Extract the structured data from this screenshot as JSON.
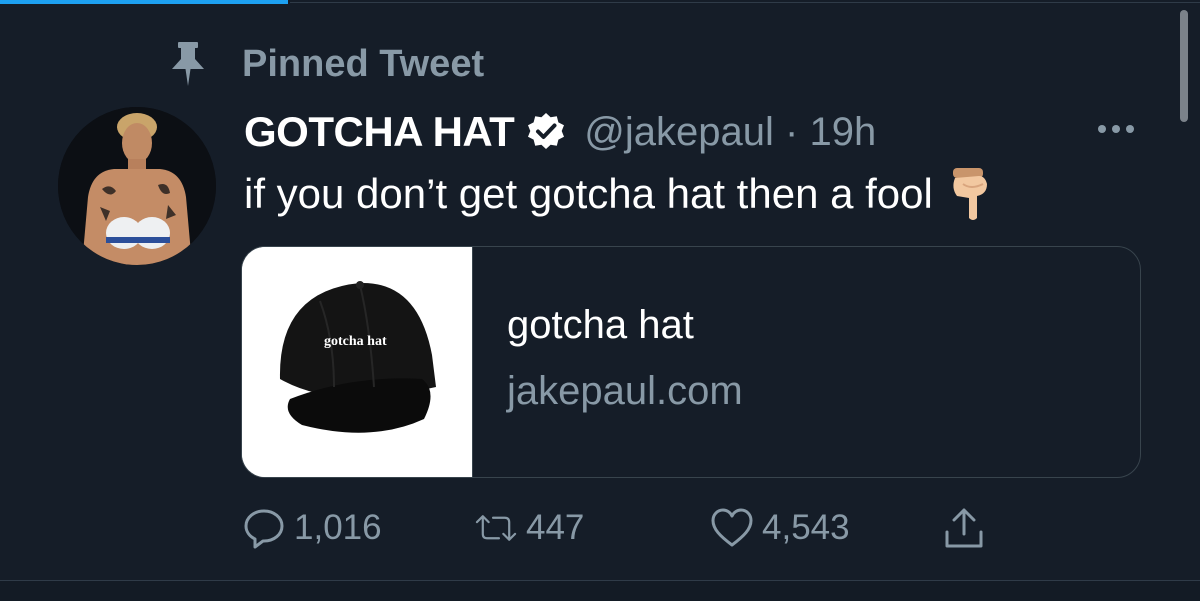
{
  "progress": {
    "fraction": 0.24,
    "color": "#1da1f2"
  },
  "pinned": {
    "label": "Pinned Tweet",
    "icon": "pin-icon"
  },
  "tweet": {
    "display_name": "GOTCHA HAT",
    "verified_icon": "verified-badge-icon",
    "handle_time": "@jakepaul · 19h",
    "more_icon": "more-options-icon",
    "text": "if you don’t get gotcha hat then a fool",
    "emoji": "pointing-down-hand-icon"
  },
  "card": {
    "hat_text": "gotcha hat",
    "title": "gotcha hat",
    "domain": "jakepaul.com"
  },
  "actions": {
    "reply": {
      "icon": "reply-icon",
      "count": "1,016"
    },
    "retweet": {
      "icon": "retweet-icon",
      "count": "447"
    },
    "like": {
      "icon": "heart-icon",
      "count": "4,543"
    },
    "share": {
      "icon": "share-icon"
    }
  },
  "colors": {
    "background": "#151d28",
    "muted": "#8899a6",
    "accent": "#1da1f2",
    "border": "#38444d"
  }
}
